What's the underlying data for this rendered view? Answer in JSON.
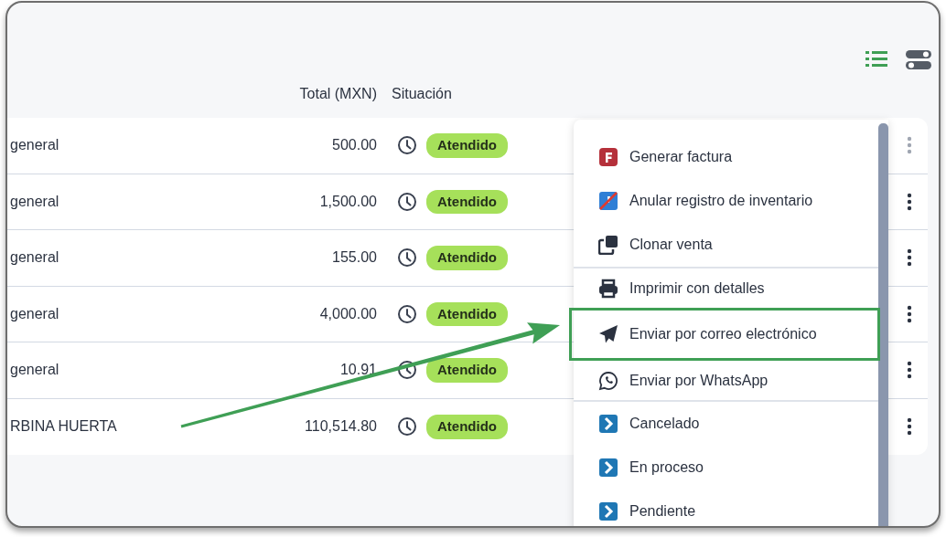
{
  "views": [
    {
      "kind": "list",
      "selected": true
    },
    {
      "kind": "toggle",
      "selected": false
    }
  ],
  "table": {
    "columns": [
      "Total (MXN)",
      "Situación"
    ],
    "rows": [
      {
        "customer": "general",
        "total": "500.00",
        "status": "Atendido",
        "menu_open": true
      },
      {
        "customer": "general",
        "total": "1,500.00",
        "status": "Atendido",
        "menu_open": false
      },
      {
        "customer": "general",
        "total": "155.00",
        "status": "Atendido",
        "menu_open": false
      },
      {
        "customer": "general",
        "total": "4,000.00",
        "status": "Atendido",
        "menu_open": false
      },
      {
        "customer": "general",
        "total": "10.91",
        "status": "Atendido",
        "menu_open": false
      },
      {
        "customer": "RBINA HUERTA",
        "total": "110,514.80",
        "status": "Atendido",
        "menu_open": false
      }
    ]
  },
  "menu": {
    "sections": [
      [
        {
          "kind": "invoice",
          "label": "Generar factura",
          "highlighted": false
        },
        {
          "kind": "void",
          "label": "Anular registro de inventario",
          "highlighted": false
        },
        {
          "kind": "clone",
          "label": "Clonar venta",
          "highlighted": false
        }
      ],
      [
        {
          "kind": "print",
          "label": "Imprimir con detalles",
          "highlighted": false
        },
        {
          "kind": "email",
          "label": "Enviar por correo electrónico",
          "highlighted": true
        },
        {
          "kind": "whatsapp",
          "label": "Enviar por WhatsApp",
          "highlighted": false
        }
      ],
      [
        {
          "kind": "status",
          "label": "Cancelado",
          "highlighted": false
        },
        {
          "kind": "status",
          "label": "En proceso",
          "highlighted": false
        },
        {
          "kind": "status",
          "label": "Pendiente",
          "highlighted": false
        }
      ]
    ]
  }
}
